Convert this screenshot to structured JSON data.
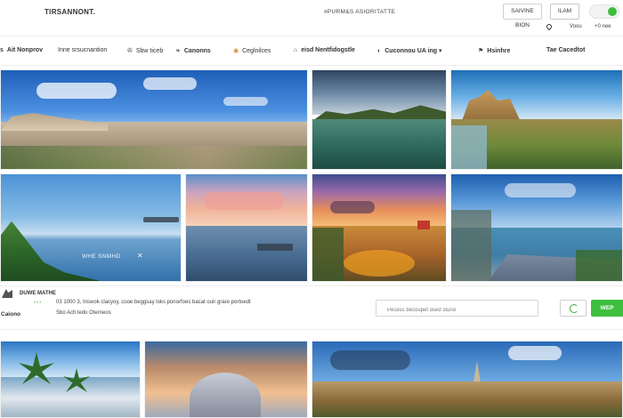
{
  "header": {
    "brand": "TIRSANNONT.",
    "center_title": "#PURM&S ASIORITATTE",
    "signin_label": "SAIVINE BION",
    "signup_label": "ILAM",
    "view_label": "Voou",
    "dropdown_label": "+0 nee"
  },
  "nav": {
    "items": [
      {
        "label": "Ait Nonprov",
        "icon": "s"
      },
      {
        "label": "Inne srsucnantion",
        "icon": ""
      },
      {
        "label": "Sbw ticeb",
        "icon": "✇"
      },
      {
        "label": "Canonns",
        "icon": "❧"
      },
      {
        "label": "Ceglnilces",
        "icon": "◉"
      },
      {
        "label": "eisd Nentfidogstle",
        "icon": "⌂"
      },
      {
        "label": "Cuconnou UA ing",
        "icon": "◐"
      },
      {
        "label": "Hsinhre",
        "icon": "⚑"
      },
      {
        "label": "Tae Cacedtot",
        "icon": ""
      }
    ],
    "dropdown_arrow": "▾"
  },
  "gallery": {
    "overlay_caption": "WHE SNMHD",
    "overlay_close": "✕"
  },
  "info": {
    "title": "DUWE MATHE",
    "place": "Caiono",
    "dots": "•••",
    "line1": "03 1000 3,  Inswok clacyoy,  cooe beggsay loks ponorfoes bacat  ouir grare portoedt",
    "line2": "Sbo Ach ledo Oterneos",
    "search_placeholder": "Pecess becoupet osed stuno",
    "go_label": "WEP"
  },
  "colors": {
    "accent": "#3fbf3f",
    "border": "#d6d6d6"
  }
}
